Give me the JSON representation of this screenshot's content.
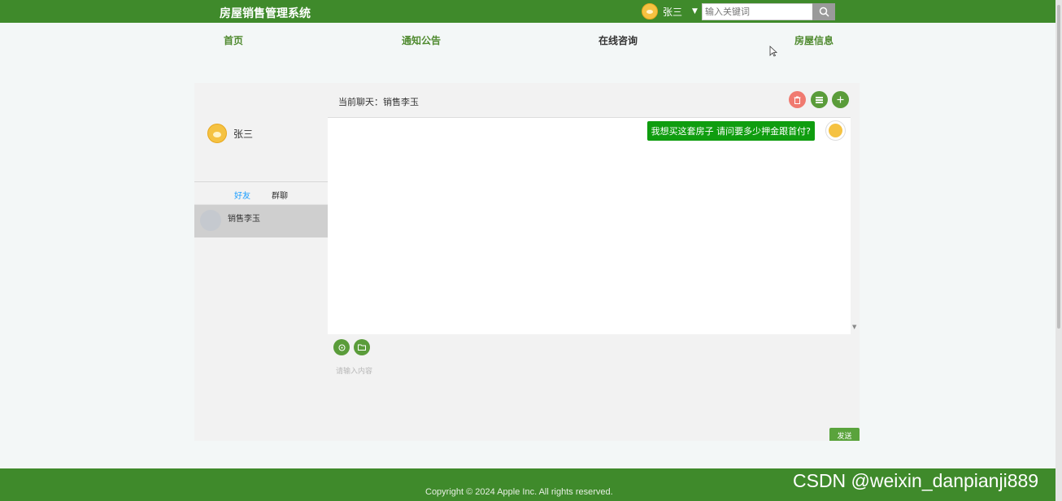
{
  "header": {
    "brand": "房屋销售管理系统",
    "user_name": "张三",
    "search_placeholder": "输入关键词"
  },
  "nav": {
    "items": [
      {
        "label": "首页",
        "active": false
      },
      {
        "label": "通知公告",
        "active": false
      },
      {
        "label": "在线咨询",
        "active": true
      },
      {
        "label": "房屋信息",
        "active": false
      }
    ]
  },
  "sidebar": {
    "me_name": "张三",
    "tabs": [
      {
        "label": "好友",
        "active": true
      },
      {
        "label": "群聊",
        "active": false
      }
    ],
    "friends": [
      {
        "name": "销售李玉"
      }
    ]
  },
  "chat": {
    "title": "当前聊天：销售李玉",
    "messages": [
      {
        "text": "我想买这套房子 请问要多少押金跟首付?",
        "from": "me"
      }
    ],
    "input_placeholder": "请输入内容",
    "send_label": "发送"
  },
  "footer": {
    "copyright": "Copyright © 2024 Apple Inc. All rights reserved."
  },
  "watermark": "CSDN @weixin_danpianji889",
  "colors": {
    "primary": "#3f8a2b",
    "bubble": "#0f9d0f",
    "delete": "#f07a70",
    "accent": "#5a9c3a",
    "tab_active": "#1e9fff"
  },
  "icons": [
    "user-avatar-icon",
    "caret-down-icon",
    "search-icon",
    "trash-icon",
    "list-icon",
    "plus-icon",
    "emoji-icon",
    "folder-icon"
  ]
}
